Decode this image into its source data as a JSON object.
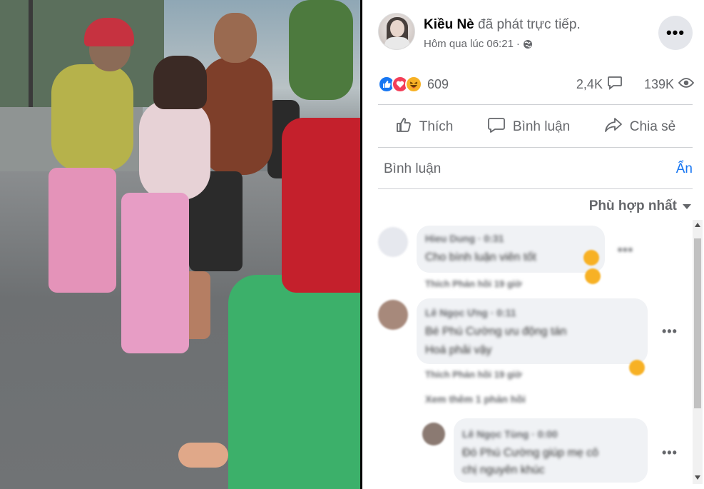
{
  "post": {
    "author_name": "Kiều Nè",
    "author_action": "đã phát trực tiếp.",
    "timestamp": "Hôm qua lúc 06:21",
    "separator": " · ",
    "privacy_icon": "globe-icon",
    "more_icon": "more-dots-icon",
    "more_label": "•••"
  },
  "stats": {
    "reactions_count": "609",
    "reaction_types": [
      "like",
      "love",
      "haha"
    ],
    "comments_count": "2,4K",
    "views_count": "139K"
  },
  "actions": {
    "like_label": "Thích",
    "comment_label": "Bình luận",
    "share_label": "Chia sẻ"
  },
  "comments_section": {
    "title": "Bình luận",
    "hide_label": "Ẩn",
    "sort_label": "Phù hợp nhất"
  },
  "comments": [
    {
      "name": "Hieu Dung · 0:31",
      "text": "Cho bình luận viên tốt",
      "meta": "Thích   Phản hồi   19 giờ",
      "more": "•••"
    },
    {
      "name": "Lê Ngọc Ưng · 0:11",
      "text_line1": "Bé Phú Cường ưu động tán",
      "text_line2": "Hoá phải vậy",
      "meta": "Thích   Phản hồi   19 giờ",
      "reply_link": "Xem thêm 1 phản hồi",
      "more": "•••"
    },
    {
      "name": "Lê Ngọc Tùng · 0:00",
      "text_line1": "Đó Phú Cường giúp mẹ cô",
      "text_line2": "chị nguyên khúc",
      "more": "•••"
    }
  ],
  "colors": {
    "accent": "#1877f2",
    "secondary_text": "#65676b",
    "bubble": "#f0f2f5",
    "like": "#1877f2",
    "love": "#f33e58",
    "haha": "#f7b125"
  }
}
